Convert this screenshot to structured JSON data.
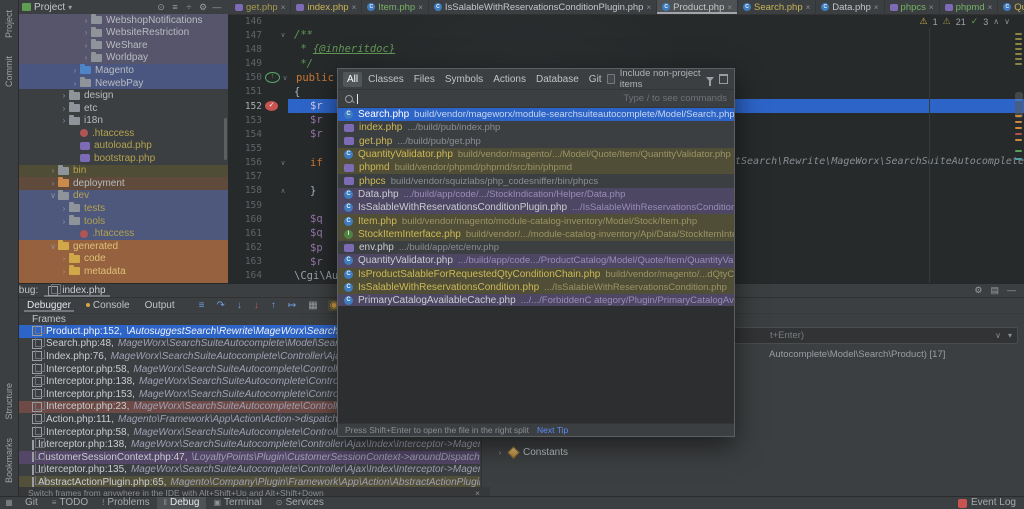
{
  "left_toolbar": {
    "top": [
      {
        "label": "Project"
      },
      {
        "label": "Commit"
      }
    ],
    "bottom": [
      {
        "label": "Structure"
      },
      {
        "label": "Bookmarks"
      }
    ]
  },
  "project": {
    "title": "Project",
    "caret": "▾",
    "header_icons": [
      {
        "g": "⊙"
      },
      {
        "g": "≡"
      },
      {
        "g": "÷"
      },
      {
        "g": "⚙"
      },
      {
        "g": "—"
      }
    ],
    "tree": [
      {
        "chev": "›",
        "icon": "folder",
        "label": "WebshopNotifications",
        "d": 4,
        "cls": "bg-lav"
      },
      {
        "chev": "›",
        "icon": "folder",
        "label": "WebsiteRestriction",
        "d": 4,
        "cls": "bg-lav"
      },
      {
        "chev": "›",
        "icon": "folder",
        "label": "WeShare",
        "d": 4,
        "cls": "bg-lav"
      },
      {
        "chev": "›",
        "icon": "folder",
        "label": "Worldpay",
        "d": 4,
        "cls": "bg-lav"
      },
      {
        "chev": "›",
        "icon": "folder-blue",
        "label": "Magento",
        "d": 3,
        "cls": "bg-blue"
      },
      {
        "chev": "›",
        "icon": "folder",
        "label": "NewebPay",
        "d": 3,
        "cls": "bg-blue"
      },
      {
        "chev": "›",
        "icon": "folder",
        "label": "design",
        "d": 2
      },
      {
        "chev": "›",
        "icon": "folder",
        "label": "etc",
        "d": 2
      },
      {
        "chev": "›",
        "icon": "folder",
        "label": "i18n",
        "d": 2
      },
      {
        "icon": "htaccess",
        "label": ".htaccess",
        "d": 3,
        "ncls": "n-oliveT"
      },
      {
        "icon": "php",
        "label": "autoload.php",
        "d": 3,
        "ncls": "n-oliveT"
      },
      {
        "icon": "php",
        "label": "bootstrap.php",
        "d": 3,
        "ncls": "n-oliveT"
      },
      {
        "chev": "›",
        "icon": "folder",
        "label": "bin",
        "d": 1,
        "cls": "bg-olive",
        "ncls": "n-oliveT"
      },
      {
        "chev": "›",
        "icon": "folder-orange",
        "label": "deployment",
        "d": 1,
        "cls": "bg-brown"
      },
      {
        "chev": "∨",
        "icon": "folder",
        "label": "dev",
        "d": 1,
        "cls": "bg-bluedim",
        "ncls": "n-oliveT"
      },
      {
        "chev": "›",
        "icon": "folder",
        "label": "tests",
        "d": 2,
        "cls": "bg-bluedim",
        "ncls": "n-oliveT"
      },
      {
        "chev": "›",
        "icon": "folder",
        "label": "tools",
        "d": 2,
        "cls": "bg-bluedim",
        "ncls": "n-oliveT"
      },
      {
        "icon": "htaccess",
        "label": ".htaccess",
        "d": 3,
        "cls": "bg-bluedim",
        "ncls": "n-oliveT"
      },
      {
        "chev": "∨",
        "icon": "folder-yellow",
        "label": "generated",
        "d": 1,
        "cls": "bg-orange",
        "ncls": "n-gold"
      },
      {
        "chev": "›",
        "icon": "folder-yellow",
        "label": "code",
        "d": 2,
        "cls": "bg-orange",
        "ncls": "n-gold"
      },
      {
        "chev": "›",
        "icon": "folder-yellow",
        "label": "metadata",
        "d": 2,
        "cls": "bg-orange",
        "ncls": "n-gold"
      },
      {
        "icon": "none",
        "label": "",
        "d": 2,
        "cls": "bg-orange"
      }
    ]
  },
  "editor": {
    "tabs": [
      {
        "label": "get.php",
        "icon": "php",
        "cls": "t-olive"
      },
      {
        "label": "index.php",
        "icon": "php",
        "cls": "t-yellow"
      },
      {
        "label": "Item.php",
        "icon": "class",
        "cls": "t-green"
      },
      {
        "label": "IsSalableWithReservationsConditionPlugin.php",
        "icon": "class",
        "cls": "t-white"
      },
      {
        "label": "Product.php",
        "icon": "class",
        "cls": "t-white active"
      },
      {
        "label": "Search.php",
        "icon": "class",
        "cls": "t-yellow"
      },
      {
        "label": "Data.php",
        "icon": "class",
        "cls": "t-white"
      },
      {
        "label": "phpcs",
        "icon": "php",
        "cls": "t-green"
      },
      {
        "label": "phpmd",
        "icon": "php",
        "cls": "t-green"
      },
      {
        "label": "QuantityValida",
        "icon": "class",
        "cls": "t-yellow noclose"
      }
    ],
    "tab_end_icons": [
      {
        "g": "∨"
      },
      {
        "g": "⋮"
      }
    ],
    "lines": [
      {
        "num": "146"
      },
      {
        "num": "147",
        "a": "/**",
        "ca": "doc",
        "fold": "∨"
      },
      {
        "num": "148",
        "a": " * ",
        "ca": "doc",
        "b": "{@inheritdoc}"
      },
      {
        "num": "149",
        "a": " */",
        "ca": "doc"
      },
      {
        "num": "150",
        "a": "public",
        "ca": "kw",
        "marker": "ovr",
        "fold": "∨"
      },
      {
        "num": "151",
        "a": "{",
        "ca": "pl"
      },
      {
        "num": "152",
        "a": "$r",
        "ca": "var",
        "marker": "bp",
        "cls": "cur",
        "ind": 1
      },
      {
        "num": "153",
        "a": "$r",
        "ca": "var",
        "ind": 1
      },
      {
        "num": "154",
        "a": "$r",
        "ca": "var",
        "ind": 1
      },
      {
        "num": "155"
      },
      {
        "num": "156",
        "a": "if",
        "ca": "kw",
        "ind": 1,
        "fold": "∨"
      },
      {
        "num": "157"
      },
      {
        "num": "158",
        "a": "}",
        "ca": "pl",
        "ind": 1,
        "fold": "∧"
      },
      {
        "num": "159"
      },
      {
        "num": "160",
        "a": "$q",
        "ca": "var",
        "ind": 1
      },
      {
        "num": "161",
        "a": "$q",
        "ca": "var",
        "ind": 1
      },
      {
        "num": "162",
        "a": "$p",
        "ca": "var",
        "ind": 1
      },
      {
        "num": "163",
        "a": "$r",
        "ca": "var",
        "ind": 1
      },
      {
        "num": "164",
        "a": "\\Cgi\\Autosugg",
        "ca": "frag"
      }
    ],
    "long_line_fragment": "tSearch\\Rewrite\\MageWorx\\SearchSuiteAutocomplete\\Blo",
    "inspections": {
      "warnings": "1",
      "weak_warnings": "21",
      "ok": "3",
      "up": "∧",
      "down": "∨"
    },
    "stripe": [
      {
        "t": 19,
        "c": "sm-olive"
      },
      {
        "t": 24,
        "c": "sm-olive"
      },
      {
        "t": 29,
        "c": "sm-olive"
      },
      {
        "t": 34,
        "c": "sm-olive"
      },
      {
        "t": 39,
        "c": "sm-olive"
      },
      {
        "t": 44,
        "c": "sm-olive"
      },
      {
        "t": 49,
        "c": "sm-olive"
      },
      {
        "t": 85,
        "c": "sm-blue"
      },
      {
        "t": 101,
        "c": "sm-orange"
      },
      {
        "t": 107,
        "c": "sm-orange"
      },
      {
        "t": 113,
        "c": "sm-orange"
      },
      {
        "t": 119,
        "c": "sm-red"
      },
      {
        "t": 125,
        "c": "sm-orange"
      },
      {
        "t": 136,
        "c": "sm-green"
      },
      {
        "t": 144,
        "c": "sm-teal"
      }
    ]
  },
  "popup": {
    "tabs": [
      {
        "label": "All",
        "cls": "active"
      },
      {
        "label": "Classes"
      },
      {
        "label": "Files"
      },
      {
        "label": "Symbols"
      },
      {
        "label": "Actions"
      },
      {
        "label": "Database"
      },
      {
        "label": "Git"
      }
    ],
    "include_label": "Include non-project items",
    "placeholder": "Type / to see commands",
    "results": [
      {
        "icon": "class",
        "name": "Search.php",
        "path": "build/vendor/mageworx/module-searchsuiteautocomplete/Model/Search.php",
        "cls": "sel"
      },
      {
        "icon": "php",
        "name": "index.php",
        "path": ".../build/pub/index.php",
        "ncls": "n-yellow"
      },
      {
        "icon": "php",
        "name": "get.php",
        "path": ".../build/pub/get.php",
        "ncls": "n-yellow"
      },
      {
        "icon": "class",
        "name": "QuantityValidator.php",
        "path": "build/vendor/magento/.../Model/Quote/Item/QuantityValidator.php",
        "cls": "row-olive",
        "ncls": "n-yellow"
      },
      {
        "icon": "php",
        "name": "phpmd",
        "path": "build/vendor/phpmd/phpmd/src/bin/phpmd",
        "cls": "row-olive",
        "ncls": "n-yellow"
      },
      {
        "icon": "php",
        "name": "phpcs",
        "path": "build/vendor/squizlabs/php_codesniffer/bin/phpcs",
        "ncls": "n-yellow"
      },
      {
        "icon": "class",
        "name": "Data.php",
        "path": ".../build/app/code/.../StockIndication/Helper/Data.php",
        "cls": "row-purple"
      },
      {
        "icon": "class",
        "name": "IsSalableWithReservationsConditionPlugin.php",
        "path": ".../IsSalableWithReservationsConditionPlugin.php",
        "cls": "row-purple"
      },
      {
        "icon": "class",
        "name": "Item.php",
        "path": "build/vendor/magento/module-catalog-inventory/Model/Stock/Item.php",
        "cls": "row-olive",
        "ncls": "n-yellow"
      },
      {
        "icon": "interface",
        "name": "StockItemInterface.php",
        "path": "build/vendor/.../module-catalog-inventory/Api/Data/StockItemInterface.php",
        "cls": "row-olive",
        "ncls": "n-yellow"
      },
      {
        "icon": "php",
        "name": "env.php",
        "path": ".../build/app/etc/env.php"
      },
      {
        "icon": "class",
        "name": "QuantityValidator.php",
        "path": ".../build/app/code.../ProductCatalog/Model/Quote/Item/QuantityValidator.php",
        "cls": "row-purple"
      },
      {
        "icon": "class",
        "name": "IsProductSalableForRequestedQtyConditionChain.php",
        "path": "build/vendor/magento/...dQtyConditionChain.php",
        "cls": "row-olive",
        "ncls": "n-yellow"
      },
      {
        "icon": "class",
        "name": "IsSalableWithReservationsCondition.php",
        "path": ".../IsSalableWithReservationsCondition.php",
        "cls": "row-olive",
        "ncls": "n-yellow"
      },
      {
        "icon": "class",
        "name": "PrimaryCatalogAvailableCache.php",
        "path": ".../.../ForbiddenC ategory/Plugin/PrimaryCatalogAvailableCache.php",
        "cls": "row-purple"
      }
    ],
    "footer_hint": "Press Shift+Enter to open the file in the right split",
    "footer_link": "Next Tip"
  },
  "debug": {
    "label": "Debug:",
    "session": "index.php",
    "header_icons": [
      {
        "g": "⚙"
      },
      {
        "g": "▤"
      },
      {
        "g": "—"
      }
    ],
    "strip": [
      {
        "g": "▶",
        "c": "g-green"
      },
      {
        "g": "‖",
        "c": "g-dim"
      },
      {
        "g": "■",
        "c": "g-red"
      },
      {
        "g": "●",
        "c": "g-red"
      },
      {
        "g": "⊘",
        "c": "g-red"
      },
      {
        "g": "⚙",
        "c": "g-dim"
      },
      {
        "g": "↗",
        "c": "g-dim"
      }
    ],
    "tabs": [
      {
        "label": "Debugger",
        "cls": "active"
      },
      {
        "label": "Console",
        "cls": "has-dot"
      },
      {
        "label": "Output"
      }
    ],
    "steps": [
      {
        "g": "≡",
        "c": "s-blue"
      },
      {
        "g": "↷",
        "c": "s-blue"
      },
      {
        "g": "↓",
        "c": "s-blue"
      },
      {
        "g": "↓",
        "c": "s-red"
      },
      {
        "g": "↑",
        "c": "s-blue"
      },
      {
        "g": "↦",
        "c": "s-blue"
      },
      {
        "g": "▦",
        "c": "s-grey"
      },
      {
        "g": "◉",
        "c": "s-gold",
        "cls": "act"
      },
      {
        "g": "≣",
        "c": "s-grey"
      },
      {
        "g": "⊕",
        "c": "s-pink"
      }
    ],
    "frames_header": "Frames",
    "frames": [
      {
        "file": "Product.php:152,",
        "det": "\\AutosuggestSearch\\Rewrite\\MageWorx\\SearchSuiteAutoco",
        "cls": "sel"
      },
      {
        "file": "Search.php:48,",
        "det": "MageWorx\\SearchSuiteAutocomplete\\Model\\Search->getData()"
      },
      {
        "file": "Index.php:76,",
        "det": "MageWorx\\SearchSuiteAutocomplete\\Controller\\Ajax\\Index->exec"
      },
      {
        "file": "Interceptor.php:58,",
        "det": "MageWorx\\SearchSuiteAutocomplete\\Controller\\Ajax\\Index\\"
      },
      {
        "file": "Interceptor.php:138,",
        "det": "MageWorx\\SearchSuiteAutocomplete\\Controller\\Ajax\\Index"
      },
      {
        "file": "Interceptor.php:153,",
        "det": "MageWorx\\SearchSuiteAutocomplete\\Controller\\Ajax\\Index"
      },
      {
        "file": "Interceptor.php:23,",
        "det": "MageWorx\\SearchSuiteAutocomplete\\Controller\\Ajax\\Index\\",
        "cls": "f-red"
      },
      {
        "file": "Action.php:111,",
        "det": "Magento\\Framework\\App\\Action\\Action->dispatch()"
      },
      {
        "file": "Interceptor.php:58,",
        "det": "MageWorx\\SearchSuiteAutocomplete\\Controller\\Ajax\\Index\\"
      },
      {
        "file": "Interceptor.php:138,",
        "det": "MageWorx\\SearchSuiteAutocomplete\\Controller\\Ajax\\Index\\Interceptor->Magento\\Framework"
      },
      {
        "file": "CustomerSessionContext.php:47,",
        "det": "\\LoyaltyPoints\\Plugin\\CustomerSessionContext->aroundDispatch()",
        "cls": "f-purple"
      },
      {
        "file": "Interceptor.php:135,",
        "det": "MageWorx\\SearchSuiteAutocomplete\\Controller\\Ajax\\Index\\Interceptor->Magento\\Framework"
      },
      {
        "file": "AbstractActionPlugin.php:65,",
        "det": "Magento\\Company\\Plugin\\Framework\\App\\Action\\AbstractActionPlugin->aroundDis",
        "cls": "f-olive"
      }
    ],
    "vars": {
      "input_fragment": "t+Enter)",
      "icons": [
        {
          "g": "∨"
        },
        {
          "g": "▾"
        }
      ],
      "value_row": "Autocomplete\\Model\\Search\\Product) [17]",
      "constants": "Constants",
      "constants_chev": "›"
    },
    "hint": "Switch frames from anywhere in the IDE with Alt+Shift+Up and Alt+Shift+Down",
    "hint_close": "×"
  },
  "status": {
    "items": [
      {
        "glyph": "",
        "label": "Git"
      },
      {
        "glyph": "≡",
        "label": "TODO"
      },
      {
        "glyph": "!",
        "label": "Problems"
      },
      {
        "glyph": "‖",
        "label": "Debug",
        "cls": "active"
      },
      {
        "glyph": "▣",
        "label": "Terminal"
      },
      {
        "glyph": "⊙",
        "label": "Services"
      }
    ],
    "right_label": "Event Log"
  }
}
